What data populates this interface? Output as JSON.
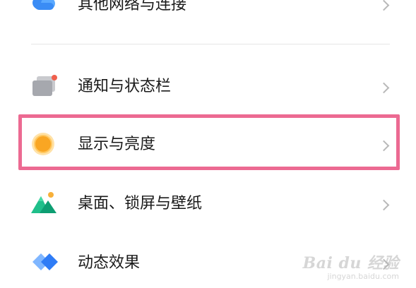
{
  "settings_list": {
    "items": [
      {
        "label": "其他网络与连接",
        "icon": "network-connection-icon"
      },
      {
        "label": "通知与状态栏",
        "icon": "notification-statusbar-icon"
      },
      {
        "label": "显示与亮度",
        "icon": "display-brightness-icon",
        "highlighted": true
      },
      {
        "label": "桌面、锁屏与壁纸",
        "icon": "wallpaper-icon"
      },
      {
        "label": "动态效果",
        "icon": "animation-effects-icon"
      }
    ]
  },
  "watermark": {
    "brand": "Bai du 经验",
    "url": "jingyan.baidu.com"
  },
  "colors": {
    "highlight_border": "#ec6a92",
    "chevron": "#b8b8b8",
    "divider": "#e6e6e6",
    "text": "#1a1a1a"
  }
}
